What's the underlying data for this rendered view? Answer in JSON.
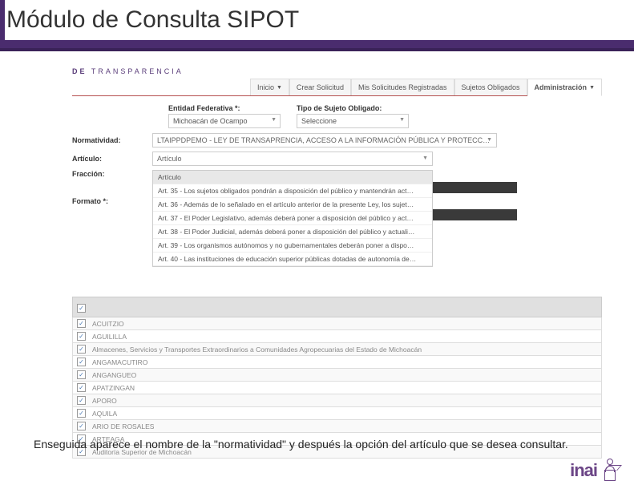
{
  "slide": {
    "title": "Módulo de Consulta SIPOT",
    "footer_text": "Enseguida aparece el nombre de la \"normatividad\" y después la opción del artículo que se desea consultar."
  },
  "brand": {
    "de": "DE",
    "transparencia": "TRANSPARENCIA"
  },
  "nav": {
    "tabs": [
      "Inicio",
      "Crear Solicitud",
      "Mis Solicitudes Registradas",
      "Sujetos Obligados",
      "Administración"
    ]
  },
  "form": {
    "entidad_label": "Entidad Federativa *:",
    "entidad_value": "Michoacán de Ocampo",
    "tipo_label": "Tipo de Sujeto Obligado:",
    "tipo_value": "Seleccione",
    "normatividad_label": "Normatividad:",
    "normatividad_value": "LTAIPPDPEMO - LEY DE TRANSAPRENCIA, ACCESO A LA INFORMACIÓN PÚBLICA Y PROTECC…",
    "articulo_label": "Artículo:",
    "articulo_value": "Artículo",
    "fraccion_label": "Fracción:",
    "formato_label": "Formato *:"
  },
  "articulo_options": [
    "Artículo",
    "Art. 35 - Los sujetos obligados pondrán a disposición del público y mantendrán act…",
    "Art. 36 - Además de lo señalado en el artículo anterior de la presente Ley, los sujet…",
    "Art. 37 - El Poder Legislativo, además deberá poner a disposición del público y act…",
    "Art. 38 - El Poder Judicial, además deberá poner a disposición del público y actuali…",
    "Art. 39 - Los organismos autónomos y no gubernamentales deberán poner a dispo…",
    "Art. 40 - Las instituciones de educación superior públicas dotadas de autonomía de…"
  ],
  "checklist": [
    "ACUITZIO",
    "AGUILILLA",
    "Almacenes, Servicios y Transportes Extraordinarios a Comunidades Agropecuarias del Estado de Michoacán",
    "ANGAMACUTIRO",
    "ANGANGUEO",
    "APATZINGAN",
    "APORO",
    "AQUILA",
    "ARIO DE ROSALES",
    "ARTEAGA",
    "Auditoría Superior de Michoacán"
  ],
  "logo": {
    "text": "inai"
  }
}
